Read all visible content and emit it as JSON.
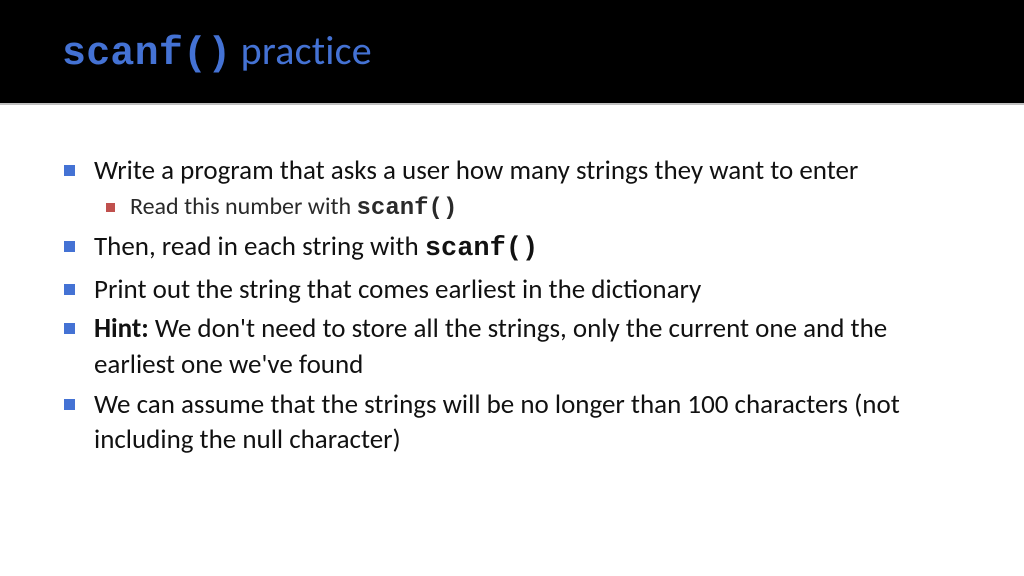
{
  "title": {
    "code": "scanf()",
    "rest": " practice"
  },
  "bullets": {
    "b1": "Write a program that asks a user how many strings they want to enter",
    "b1a_pre": "Read this number with ",
    "b1a_code": "scanf()",
    "b2_pre": "Then, read in each string with ",
    "b2_code": "scanf()",
    "b3": "Print out the string that comes earliest in the dictionary",
    "b4_hint": "Hint:",
    "b4_rest": " We don't need to store all the strings, only the current one and the earliest one we've found",
    "b5": "We can assume that the strings will be no longer than 100 characters (not including the null character)"
  }
}
